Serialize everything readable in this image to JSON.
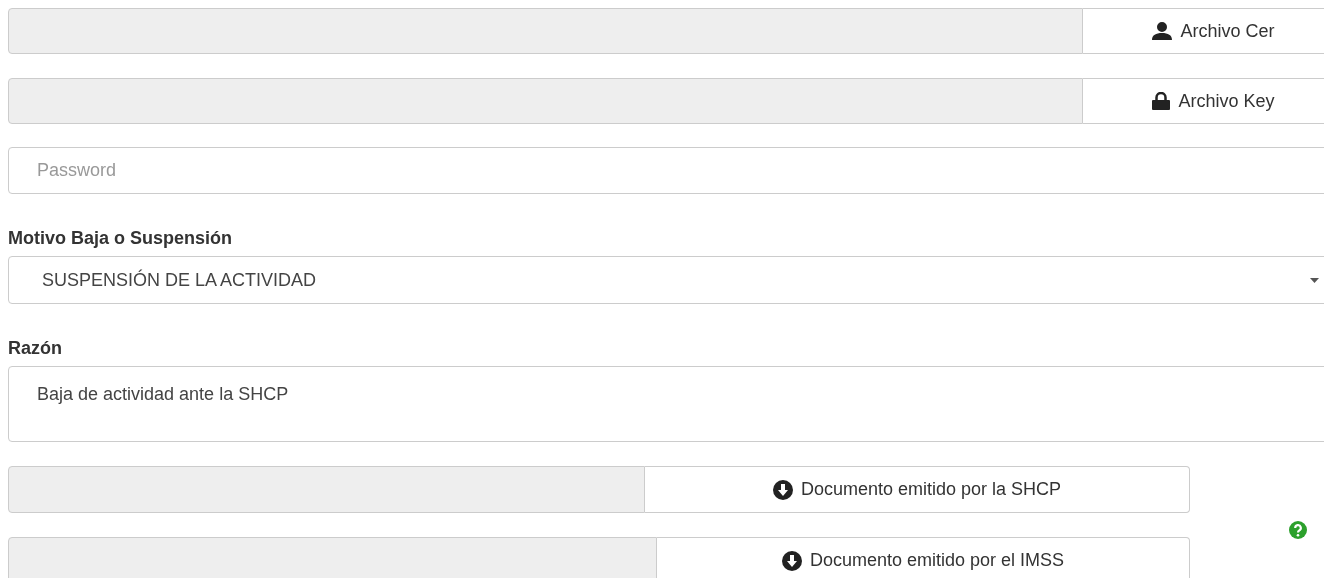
{
  "certificate_files": [
    {
      "kind": "user",
      "button": "Archivo Cer"
    },
    {
      "kind": "lock",
      "button": "Archivo Key"
    }
  ],
  "password": {
    "placeholder": "Password"
  },
  "motivo": {
    "label": "Motivo Baja o Suspensión",
    "value": "SUSPENSIÓN DE LA ACTIVIDAD"
  },
  "razon": {
    "label": "Razón",
    "value": "Baja de actividad ante la SHCP"
  },
  "documents": [
    {
      "button": "Documento emitido por la SHCP",
      "help": false
    },
    {
      "button": "Documento emitido por el IMSS",
      "help": true
    }
  ]
}
